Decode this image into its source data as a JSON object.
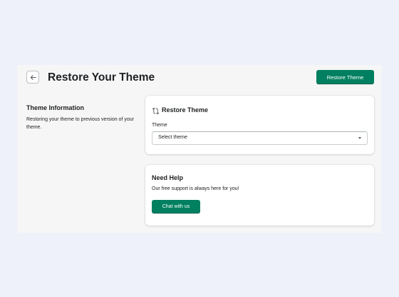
{
  "header": {
    "title": "Restore Your Theme",
    "back_icon": "arrow-left-icon",
    "primary_action_label": "Restore Theme",
    "primary_color": "#008060"
  },
  "info_section": {
    "title": "Theme Information",
    "description": "Restoring your theme to previous version of your theme."
  },
  "restore_card": {
    "icon": "restore-arrows-icon",
    "title": "Restore Theme",
    "field_label": "Theme",
    "select_value": "Select theme"
  },
  "help_card": {
    "title": "Need Help",
    "description": "Our free support is always here for you!",
    "button_label": "Chat with us"
  }
}
